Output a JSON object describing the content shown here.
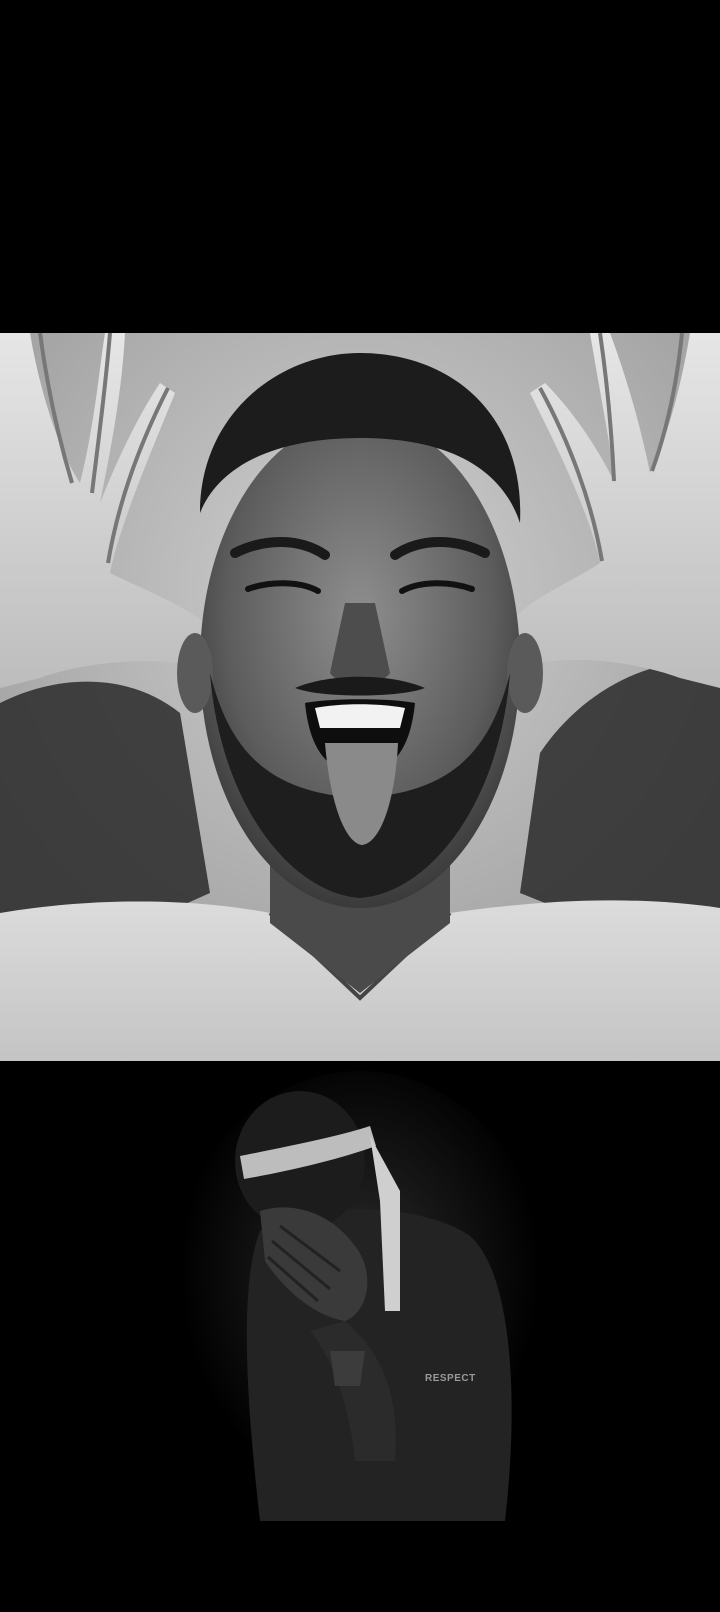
{
  "video": {
    "top_frame": {
      "description_type": "photo",
      "tone": "grayscale"
    },
    "bottom_frame": {
      "description_type": "photo",
      "tone": "grayscale",
      "sleeve_patch_text": "RESPECT"
    }
  },
  "colors": {
    "background": "#000000",
    "top_backdrop": "#b8b8b8"
  }
}
